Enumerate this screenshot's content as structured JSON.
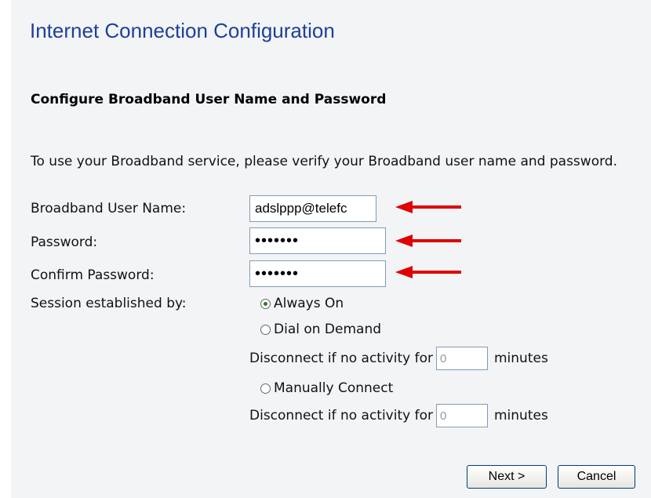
{
  "page": {
    "title": "Internet Connection Configuration",
    "subtitle": "Configure Broadband User Name and Password",
    "intro": "To use your Broadband service, please verify your Broadband user name and password."
  },
  "form": {
    "username_label": "Broadband User Name:",
    "username_value": "adslppp@telefc",
    "password_label": "Password:",
    "password_value": "•••••••",
    "confirm_label": "Confirm Password:",
    "confirm_value": "•••••••",
    "session_label": "Session established by:",
    "options": {
      "always_on": "Always On",
      "dial_on_demand": "Dial on Demand",
      "manually_connect": "Manually Connect"
    },
    "selected": "Always On",
    "disconnect_prefix": "Disconnect if no activity for",
    "disconnect_suffix": "minutes",
    "dial_timeout": "0",
    "manual_timeout": "0"
  },
  "buttons": {
    "next": "Next >",
    "cancel": "Cancel"
  },
  "colors": {
    "title": "#1f3f99",
    "annotation_arrow": "#e00000"
  }
}
